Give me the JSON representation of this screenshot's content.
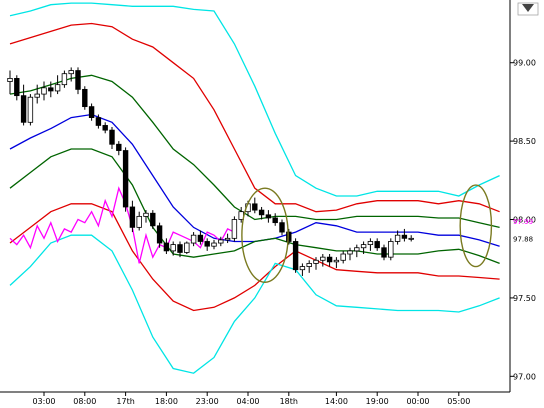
{
  "chart_data": {
    "type": "candlestick",
    "y_ticks": [
      "99.00",
      "98.50",
      "98.00",
      "97.50",
      "97.00"
    ],
    "y_tick_values": [
      99.0,
      98.5,
      98.0,
      97.5,
      97.0
    ],
    "x_ticks": [
      "03:00",
      "08:00",
      "17th",
      "18:00",
      "23:00",
      "04:00",
      "18th",
      "14:00",
      "19:00",
      "00:00",
      "05:00"
    ],
    "x_tick_index": [
      5,
      11,
      17,
      23,
      29,
      35,
      41,
      48,
      54,
      60,
      66
    ],
    "ylim": [
      96.9,
      99.4
    ],
    "price_labels": {
      "upper": {
        "text": "97.99",
        "value": 97.99,
        "color": "#ff00ff"
      },
      "current": {
        "text": "97.88",
        "value": 97.88,
        "color": "#000000"
      }
    },
    "candles": [
      [
        98.88,
        98.95,
        98.8,
        98.9
      ],
      [
        98.9,
        98.92,
        98.76,
        98.79
      ],
      [
        98.79,
        98.86,
        98.6,
        98.62
      ],
      [
        98.62,
        98.8,
        98.6,
        98.78
      ],
      [
        98.78,
        98.86,
        98.74,
        98.8
      ],
      [
        98.8,
        98.88,
        98.76,
        98.84
      ],
      [
        98.84,
        98.88,
        98.78,
        98.82
      ],
      [
        98.82,
        98.92,
        98.8,
        98.86
      ],
      [
        98.86,
        98.95,
        98.84,
        98.93
      ],
      [
        98.93,
        98.97,
        98.88,
        98.95
      ],
      [
        98.95,
        98.97,
        98.8,
        98.83
      ],
      [
        98.83,
        98.85,
        98.7,
        98.72
      ],
      [
        98.72,
        98.74,
        98.63,
        98.65
      ],
      [
        98.65,
        98.67,
        98.58,
        98.6
      ],
      [
        98.6,
        98.62,
        98.55,
        98.57
      ],
      [
        98.57,
        98.59,
        98.45,
        98.48
      ],
      [
        98.48,
        98.5,
        98.41,
        98.44
      ],
      [
        98.44,
        98.46,
        98.05,
        98.08
      ],
      [
        98.08,
        98.12,
        97.92,
        97.95
      ],
      [
        97.95,
        98.05,
        97.93,
        98.02
      ],
      [
        98.02,
        98.06,
        97.98,
        98.04
      ],
      [
        98.04,
        98.06,
        97.94,
        97.96
      ],
      [
        97.96,
        97.98,
        97.82,
        97.85
      ],
      [
        97.85,
        97.88,
        97.78,
        97.8
      ],
      [
        97.8,
        97.86,
        97.77,
        97.84
      ],
      [
        97.84,
        97.86,
        97.76,
        97.79
      ],
      [
        97.79,
        97.86,
        97.78,
        97.85
      ],
      [
        97.85,
        97.92,
        97.83,
        97.9
      ],
      [
        97.9,
        97.93,
        97.84,
        97.86
      ],
      [
        97.86,
        97.88,
        97.8,
        97.83
      ],
      [
        97.83,
        97.87,
        97.81,
        97.85
      ],
      [
        97.85,
        97.89,
        97.83,
        97.87
      ],
      [
        97.87,
        97.91,
        97.85,
        97.88
      ],
      [
        97.88,
        98.02,
        97.86,
        98.0
      ],
      [
        98.0,
        98.08,
        97.98,
        98.05
      ],
      [
        98.05,
        98.12,
        98.02,
        98.1
      ],
      [
        98.1,
        98.14,
        98.04,
        98.06
      ],
      [
        98.06,
        98.08,
        98.0,
        98.03
      ],
      [
        98.03,
        98.06,
        97.98,
        98.01
      ],
      [
        98.01,
        98.04,
        97.96,
        97.98
      ],
      [
        97.98,
        98.0,
        97.9,
        97.92
      ],
      [
        97.92,
        97.94,
        97.84,
        97.86
      ],
      [
        97.86,
        97.88,
        97.66,
        97.68
      ],
      [
        97.68,
        97.72,
        97.64,
        97.7
      ],
      [
        97.7,
        97.74,
        97.66,
        97.72
      ],
      [
        97.72,
        97.76,
        97.68,
        97.74
      ],
      [
        97.74,
        97.78,
        97.7,
        97.76
      ],
      [
        97.76,
        97.78,
        97.7,
        97.73
      ],
      [
        97.73,
        97.76,
        97.69,
        97.74
      ],
      [
        97.74,
        97.8,
        97.72,
        97.78
      ],
      [
        97.78,
        97.82,
        97.74,
        97.8
      ],
      [
        97.8,
        97.84,
        97.76,
        97.82
      ],
      [
        97.82,
        97.86,
        97.78,
        97.84
      ],
      [
        97.84,
        97.88,
        97.8,
        97.86
      ],
      [
        97.86,
        97.88,
        97.8,
        97.82
      ],
      [
        97.82,
        97.84,
        97.74,
        97.76
      ],
      [
        97.76,
        97.88,
        97.74,
        97.86
      ],
      [
        97.86,
        97.93,
        97.84,
        97.9
      ],
      [
        97.9,
        97.94,
        97.86,
        97.88
      ],
      [
        97.88,
        97.9,
        97.86,
        97.88
      ]
    ],
    "bands": [
      {
        "color": "#00e5e5",
        "values": [
          99.3,
          99.33,
          99.37,
          99.38,
          99.38,
          99.37,
          99.36,
          99.36,
          99.36,
          99.34,
          99.33,
          99.12,
          98.85,
          98.55,
          98.28,
          98.2,
          98.15,
          98.15,
          98.18,
          98.18,
          98.18,
          98.18,
          98.15,
          98.22,
          98.28
        ]
      },
      {
        "color": "#e00000",
        "values": [
          99.12,
          99.16,
          99.2,
          99.24,
          99.25,
          99.23,
          99.15,
          99.1,
          99.0,
          98.9,
          98.7,
          98.45,
          98.2,
          98.1,
          98.1,
          98.05,
          98.06,
          98.1,
          98.12,
          98.12,
          98.12,
          98.1,
          98.12,
          98.1,
          98.05
        ]
      },
      {
        "color": "#006400",
        "values": [
          98.8,
          98.82,
          98.86,
          98.9,
          98.92,
          98.88,
          98.78,
          98.62,
          98.45,
          98.35,
          98.22,
          98.08,
          98.0,
          98.02,
          98.02,
          98.0,
          98.0,
          98.02,
          98.02,
          98.02,
          98.02,
          98.01,
          98.01,
          97.98,
          97.95
        ]
      },
      {
        "color": "#0000dd",
        "values": [
          98.45,
          98.52,
          98.58,
          98.65,
          98.67,
          98.62,
          98.48,
          98.28,
          98.08,
          97.95,
          97.88,
          97.86,
          97.86,
          97.88,
          97.92,
          97.98,
          97.96,
          97.92,
          97.92,
          97.92,
          97.92,
          97.9,
          97.9,
          97.87,
          97.83
        ]
      },
      {
        "color": "#006400",
        "values": [
          98.2,
          98.3,
          98.4,
          98.45,
          98.45,
          98.4,
          98.22,
          97.95,
          97.78,
          97.76,
          97.78,
          97.8,
          97.86,
          97.88,
          97.84,
          97.82,
          97.8,
          97.8,
          97.78,
          97.78,
          97.78,
          97.8,
          97.81,
          97.77,
          97.72
        ]
      },
      {
        "color": "#e00000",
        "values": [
          97.85,
          97.95,
          98.05,
          98.1,
          98.1,
          98.05,
          97.8,
          97.62,
          97.48,
          97.42,
          97.44,
          97.5,
          97.58,
          97.7,
          97.8,
          97.74,
          97.68,
          97.67,
          97.66,
          97.66,
          97.66,
          97.64,
          97.64,
          97.63,
          97.62
        ]
      },
      {
        "color": "#00e5e5",
        "values": [
          97.58,
          97.7,
          97.85,
          97.9,
          97.9,
          97.8,
          97.55,
          97.25,
          97.05,
          97.02,
          97.12,
          97.35,
          97.5,
          97.72,
          97.68,
          97.52,
          97.45,
          97.44,
          97.43,
          97.42,
          97.42,
          97.42,
          97.41,
          97.45,
          97.5
        ]
      }
    ],
    "band_x_index": [
      0,
      3,
      6,
      9,
      12,
      15,
      18,
      21,
      24,
      27,
      30,
      33,
      36,
      39,
      42,
      45,
      48,
      51,
      54,
      57,
      60,
      63,
      66,
      69,
      72
    ],
    "magenta_line": {
      "color": "#ff00ff",
      "values": [
        97.88,
        97.84,
        97.9,
        97.82,
        97.96,
        97.88,
        97.98,
        97.86,
        97.94,
        97.92,
        98.0,
        97.98,
        98.05,
        97.96,
        98.12,
        98.02,
        98.2,
        98.1,
        97.95,
        97.72,
        97.9,
        97.76,
        97.84,
        97.82,
        97.92,
        97.9,
        97.88,
        97.86,
        97.82,
        97.92,
        97.9,
        97.86,
        97.94,
        97.92
      ],
      "x_index": [
        0,
        1,
        2,
        3,
        4,
        5,
        6,
        7,
        8,
        9,
        10,
        11,
        12,
        13,
        14,
        15,
        16,
        17,
        18,
        19,
        20,
        21,
        22,
        23,
        24,
        25,
        26,
        27,
        28,
        29,
        30,
        31,
        32,
        33
      ]
    },
    "ellipses": [
      {
        "center_index": 37.5,
        "center_value": 97.9,
        "rx_bars": 3.4,
        "ry_value": 0.3,
        "color": "#7a7a20"
      },
      {
        "center_index": 68.5,
        "center_value": 97.96,
        "rx_bars": 2.3,
        "ry_value": 0.26,
        "color": "#7a7a20"
      }
    ],
    "colors": {
      "bull": "#ffffff",
      "bear": "#000000",
      "wick": "#000000",
      "axis": "#000000",
      "frame": "#000000"
    },
    "grid": false,
    "legend": "none"
  }
}
